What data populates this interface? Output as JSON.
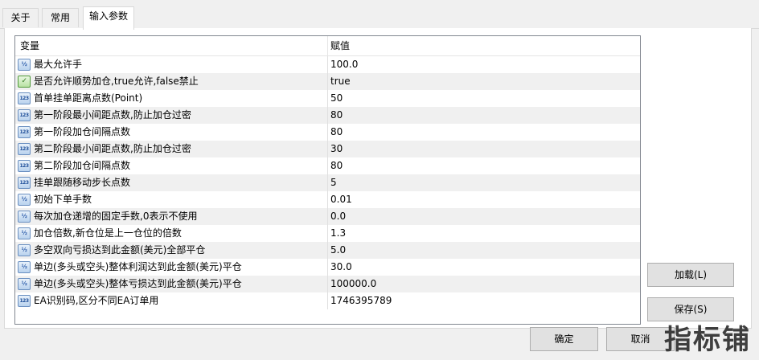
{
  "tabs": [
    {
      "label": "关于"
    },
    {
      "label": "常用"
    },
    {
      "label": "输入参数"
    }
  ],
  "table": {
    "headers": {
      "variable": "变量",
      "value": "赋值"
    },
    "rows": [
      {
        "icon": "double-type-icon",
        "name": "最大允许手",
        "value": "100.0"
      },
      {
        "icon": "bool-type-icon",
        "name": "是否允许顺势加仓,true允许,false禁止",
        "value": "true"
      },
      {
        "icon": "int-type-icon",
        "name": "首单挂单距离点数(Point)",
        "value": "50"
      },
      {
        "icon": "int-type-icon",
        "name": "第一阶段最小间距点数,防止加仓过密",
        "value": "80"
      },
      {
        "icon": "int-type-icon",
        "name": "第一阶段加仓间隔点数",
        "value": "80"
      },
      {
        "icon": "int-type-icon",
        "name": "第二阶段最小间距点数,防止加仓过密",
        "value": "30"
      },
      {
        "icon": "int-type-icon",
        "name": "第二阶段加仓间隔点数",
        "value": "80"
      },
      {
        "icon": "int-type-icon",
        "name": "挂单跟随移动步长点数",
        "value": "5"
      },
      {
        "icon": "double-type-icon",
        "name": "初始下单手数",
        "value": "0.01"
      },
      {
        "icon": "double-type-icon",
        "name": "每次加仓递增的固定手数,0表示不使用",
        "value": "0.0"
      },
      {
        "icon": "double-type-icon",
        "name": "加仓倍数,新仓位是上一仓位的倍数",
        "value": "1.3"
      },
      {
        "icon": "double-type-icon",
        "name": "多空双向亏损达到此金额(美元)全部平仓",
        "value": "5.0"
      },
      {
        "icon": "double-type-icon",
        "name": "单边(多头或空头)整体利润达到此金额(美元)平仓",
        "value": "30.0"
      },
      {
        "icon": "double-type-icon",
        "name": "单边(多头或空头)整体亏损达到此金额(美元)平仓",
        "value": "100000.0"
      },
      {
        "icon": "int-type-icon",
        "name": "EA识别码,区分不同EA订单用",
        "value": "1746395789"
      }
    ]
  },
  "buttons": {
    "load": "加载(L)",
    "save": "保存(S)",
    "ok": "确定",
    "cancel": "取消"
  },
  "watermark": "指标铺",
  "icon_text": {
    "int": "123",
    "double": "½",
    "bool": "✓"
  }
}
